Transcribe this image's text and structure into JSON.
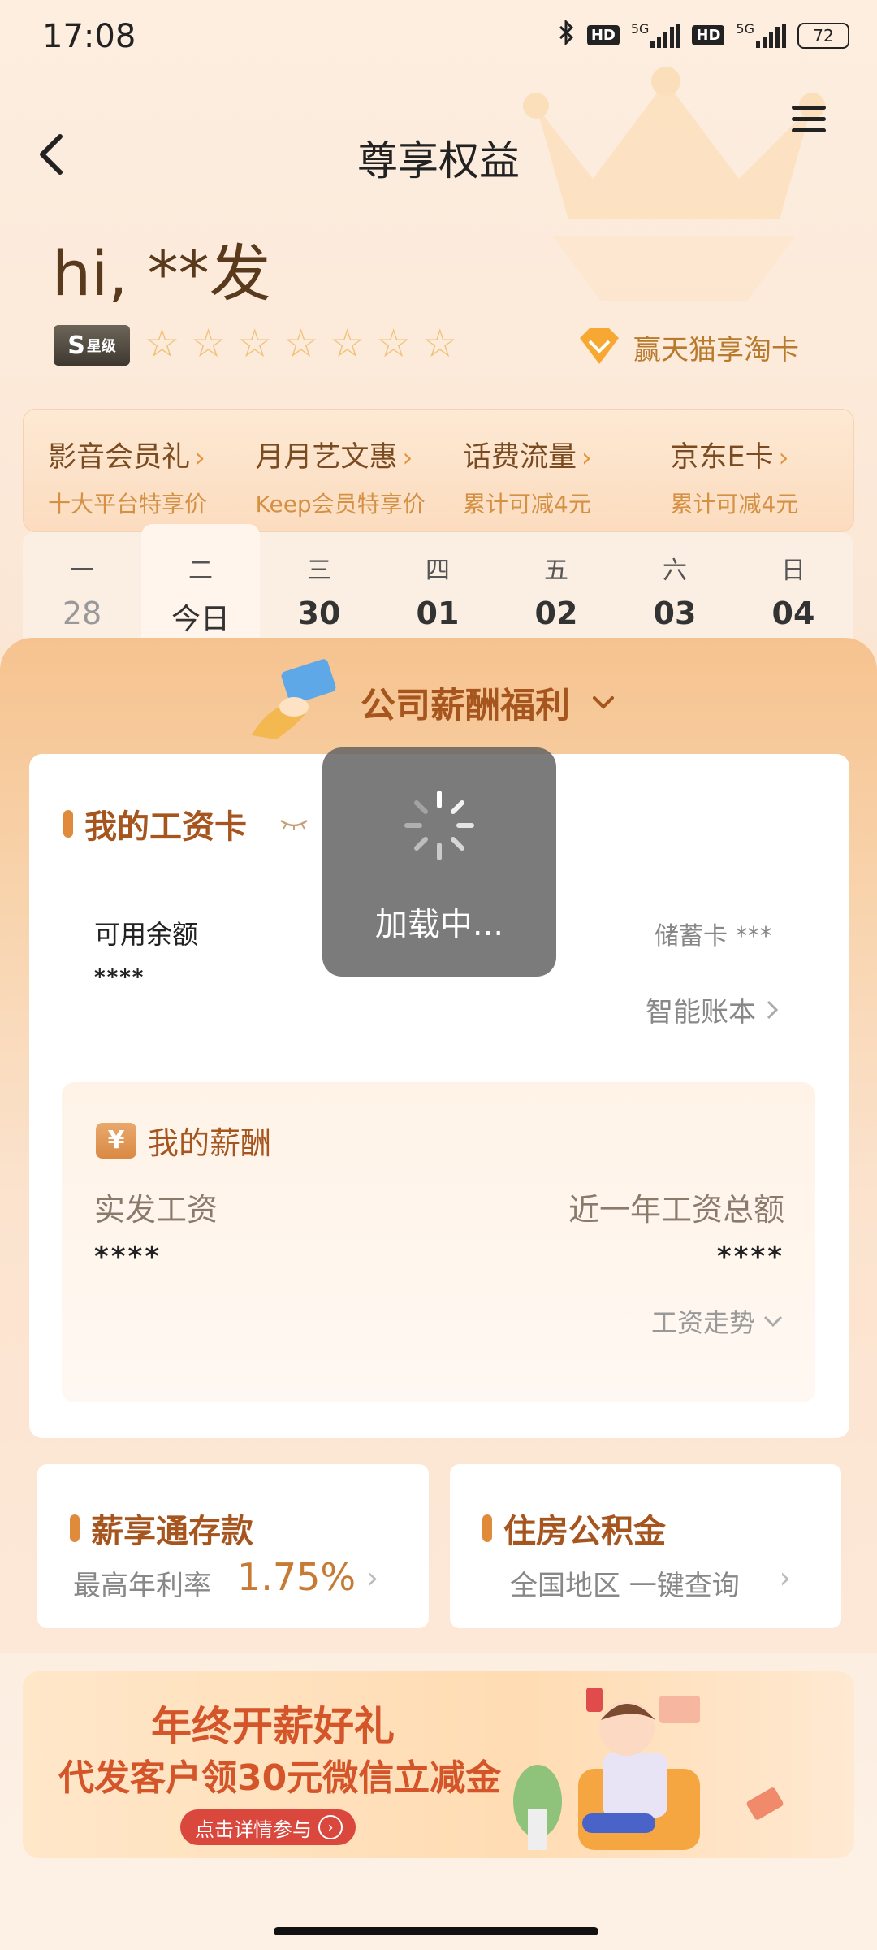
{
  "status_bar": {
    "time": "17:08",
    "network1": "5G",
    "network2": "5G",
    "hd": "HD",
    "battery": "72"
  },
  "header": {
    "title": "尊享权益"
  },
  "greeting": "hi, **发",
  "level_badge": {
    "main": "S",
    "sub": "星级",
    "stars": 7
  },
  "tmall_card": {
    "label": "赢天猫享淘卡"
  },
  "benefits": [
    {
      "title": "影音会员礼",
      "sub": "十大平台特享价"
    },
    {
      "title": "月月艺文惠",
      "sub": "Keep会员特享价"
    },
    {
      "title": "话费流量",
      "sub": "累计可减4元"
    },
    {
      "title": "京东E卡",
      "sub": "累计可减4元"
    }
  ],
  "calendar": [
    {
      "dow": "一",
      "date": "28"
    },
    {
      "dow": "二",
      "date": "今日"
    },
    {
      "dow": "三",
      "date": "30"
    },
    {
      "dow": "四",
      "date": "01"
    },
    {
      "dow": "五",
      "date": "02"
    },
    {
      "dow": "六",
      "date": "03"
    },
    {
      "dow": "日",
      "date": "04"
    }
  ],
  "welfare": {
    "title": "公司薪酬福利"
  },
  "salary_card": {
    "title": "我的工资卡",
    "available_label": "可用余额",
    "available_value": "****",
    "debit_label": "储蓄卡 ***",
    "ledger_label": "智能账本"
  },
  "my_salary": {
    "title": "我的薪酬",
    "net_label": "实发工资",
    "net_value": "****",
    "year_label": "近一年工资总额",
    "year_value": "****",
    "trend_label": "工资走势"
  },
  "deposit": {
    "title": "薪享通存款",
    "sub": "最高年利率",
    "rate": "1.75%"
  },
  "housing": {
    "title": "住房公积金",
    "sub": "全国地区 一键查询"
  },
  "banner": {
    "line1": "年终开薪好礼",
    "line2": "代发客户领30元微信立减金",
    "button": "点击详情参与"
  },
  "loading": {
    "text": "加载中..."
  },
  "colors": {
    "accent": "#a5551d",
    "orange": "#e08a3c",
    "banner_red": "#d4552a"
  }
}
